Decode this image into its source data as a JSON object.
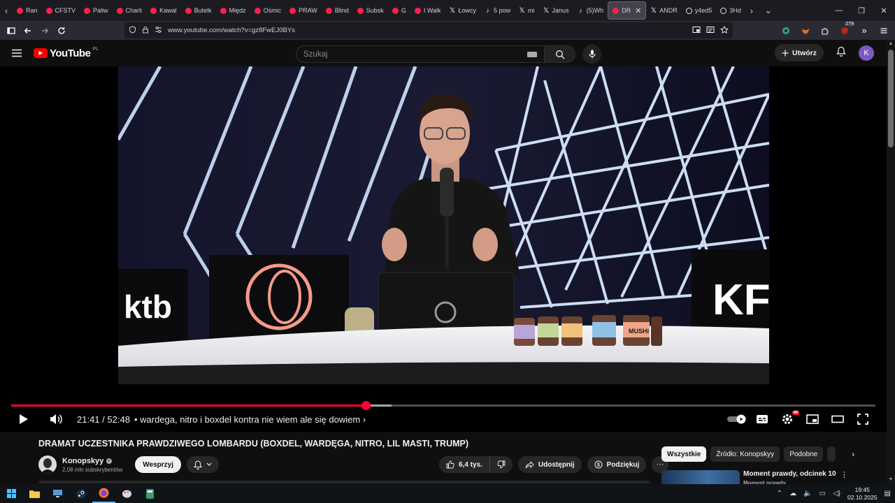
{
  "browser": {
    "tabs": [
      {
        "label": "Ran",
        "icon": "youtube"
      },
      {
        "label": "CFSTV",
        "icon": "youtube"
      },
      {
        "label": "Paliw",
        "icon": "youtube"
      },
      {
        "label": "Charli",
        "icon": "youtube"
      },
      {
        "label": "Kawal",
        "icon": "youtube"
      },
      {
        "label": "Butelk",
        "icon": "youtube"
      },
      {
        "label": "Międz",
        "icon": "youtube"
      },
      {
        "label": "Ośmic",
        "icon": "youtube"
      },
      {
        "label": "PRAW",
        "icon": "youtube"
      },
      {
        "label": "Blind",
        "icon": "youtube"
      },
      {
        "label": "Subsk",
        "icon": "youtube"
      },
      {
        "label": "G",
        "icon": "youtube"
      },
      {
        "label": "I Walk",
        "icon": "youtube"
      },
      {
        "label": "Łowcy",
        "icon": "x"
      },
      {
        "label": "5 pow",
        "icon": "tiktok"
      },
      {
        "label": "mi",
        "icon": "x"
      },
      {
        "label": "Janus",
        "icon": "x"
      },
      {
        "label": "(5)Wh",
        "icon": "tiktok"
      },
      {
        "label": "DR",
        "icon": "youtube",
        "active": true
      },
      {
        "label": "ANDR",
        "icon": "x"
      },
      {
        "label": "y4ed5",
        "icon": "generic"
      },
      {
        "label": "3Hd",
        "icon": "generic"
      }
    ],
    "url": "www.youtube.com/watch?v=gz8FwEJ0BYs",
    "extension_badge": "279"
  },
  "masthead": {
    "logo_text": "YouTube",
    "country": "PL",
    "search_placeholder": "Szukaj",
    "create_label": "Utwórz",
    "avatar_letter": "K"
  },
  "player": {
    "current_time": "21:41",
    "separator": "/",
    "duration": "52:48",
    "chapter": "• wardega, nitro i boxdel kontra nie wiem ale się dowiem",
    "progress_fraction": 0.41,
    "buffer_fraction": 0.44,
    "quality_badge": "4K",
    "video_text_left": "ktb",
    "video_text_right": "KF",
    "video_jar_label": "MUSHi"
  },
  "video": {
    "title": "DRAMAT UCZESTNIKA PRAWDZIWEGO LOMBARDU (BOXDEL, WARDĘGA, NITRO, LIL MASTI, TRUMP)",
    "channel_name": "Konopskyy",
    "subscribers": "2,08 mln subskrybentów",
    "join_label": "Wesprzyj",
    "likes": "6,4 tys.",
    "share_label": "Udostępnij",
    "thanks_label": "Podziękuj"
  },
  "sidebar": {
    "chips": [
      "Wszystkie",
      "Źródło: Konopskyy",
      "Podobne"
    ],
    "recommendation": {
      "title": "Moment prawdy, odcinek 10",
      "subtitle": "Moment prawdy"
    }
  },
  "taskbar": {
    "time": "19:45",
    "date": "02.10.2025"
  },
  "colors": {
    "accent": "#ff0033",
    "background": "#0f0f0f",
    "pill": "#272727",
    "browser_chrome": "#2b2a33"
  }
}
